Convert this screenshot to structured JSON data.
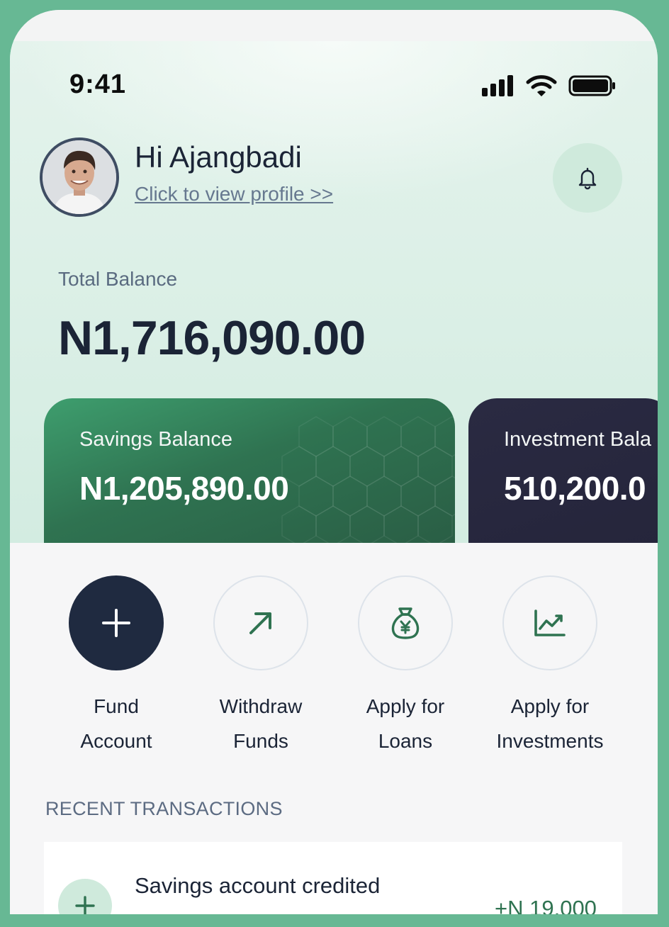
{
  "status_bar": {
    "time": "9:41"
  },
  "header": {
    "greeting": "Hi Ajangbadi",
    "profile_link": "Click to view profile >>"
  },
  "balance": {
    "label": "Total Balance",
    "value": "N1,716,090.00"
  },
  "cards": [
    {
      "label": "Savings Balance",
      "value": "N1,205,890.00"
    },
    {
      "label": "Investment Bala",
      "value": "510,200.0"
    }
  ],
  "actions": [
    {
      "line1": "Fund",
      "line2": "Account",
      "icon": "plus-icon"
    },
    {
      "line1": "Withdraw",
      "line2": "Funds",
      "icon": "arrow-up-right-icon"
    },
    {
      "line1": "Apply for",
      "line2": "Loans",
      "icon": "money-bag-icon"
    },
    {
      "line1": "Apply for",
      "line2": "Investments",
      "icon": "chart-line-icon"
    }
  ],
  "transactions": {
    "title": "RECENT TRANSACTIONS",
    "items": [
      {
        "title": "Savings account credited",
        "amount": "+N 19,000",
        "icon": "plus-icon"
      }
    ]
  },
  "colors": {
    "outer_frame": "#67b894",
    "primary_dark": "#1f2a40",
    "accent_green": "#2f7351",
    "mint": "#cfeadc"
  }
}
